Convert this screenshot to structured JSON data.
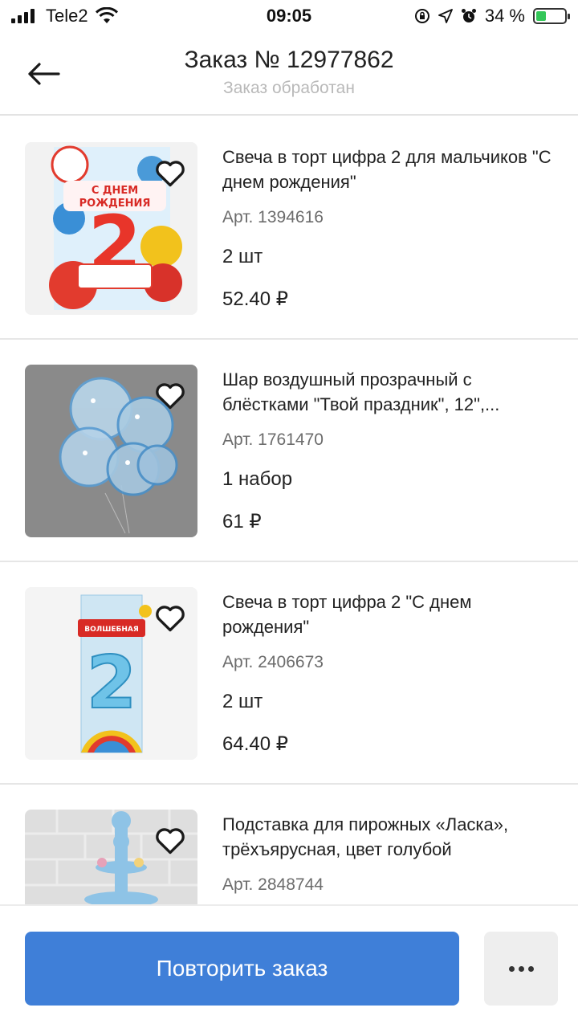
{
  "status_bar": {
    "carrier": "Tele2",
    "time": "09:05",
    "battery": "34 %",
    "battery_level": 0.34,
    "icons": [
      "signal-icon",
      "wifi-icon",
      "orientation-lock-icon",
      "location-icon",
      "alarm-icon",
      "battery-icon"
    ]
  },
  "header": {
    "title": "Заказ № 12977862",
    "subtitle": "Заказ обработан"
  },
  "items": [
    {
      "name": "Свеча в торт цифра 2 для мальчиков \"С днем рождения\"",
      "article": "Арт. 1394616",
      "quantity": "2 шт",
      "price": "52.40 ₽"
    },
    {
      "name": "Шар воздушный прозрачный с блёстками \"Твой праздник\", 12\",...",
      "article": "Арт. 1761470",
      "quantity": "1 набор",
      "price": "61 ₽"
    },
    {
      "name": "Свеча в торт цифра 2 \"С днем рождения\"",
      "article": "Арт. 2406673",
      "quantity": "2 шт",
      "price": "64.40 ₽"
    },
    {
      "name": "Подставка для пирожных «Ласка», трёхъярусная, цвет голубой",
      "article": "Арт. 2848744",
      "quantity": "",
      "price": ""
    }
  ],
  "footer": {
    "repeat_label": "Повторить заказ"
  },
  "colors": {
    "accent": "#3f7fd8",
    "battery_fill": "#34c759"
  }
}
